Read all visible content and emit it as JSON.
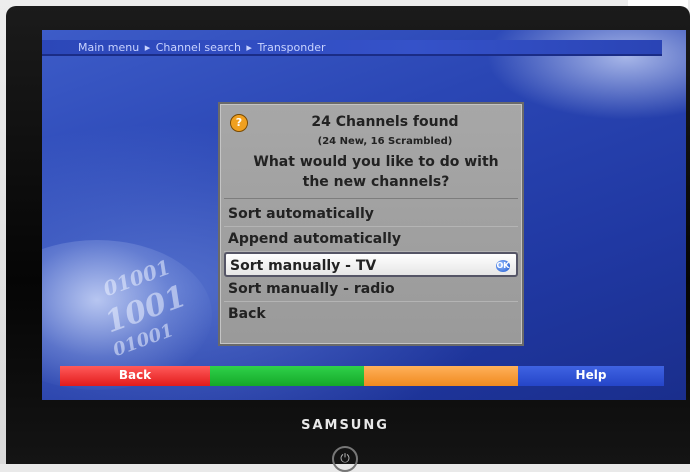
{
  "breadcrumb": {
    "items": [
      "Main menu",
      "Channel search",
      "Transponder"
    ],
    "separator": "▸"
  },
  "dialog": {
    "icon": "question-icon",
    "icon_glyph": "?",
    "title": "24 Channels found",
    "subtitle": "(24 New, 16 Scrambled)",
    "question_line1": "What would you like to do with",
    "question_line2": "the new channels?",
    "options": [
      "Sort automatically",
      "Append automatically",
      "Sort manually - TV",
      "Sort manually - radio",
      "Back"
    ],
    "selected_index": 2
  },
  "color_keys": {
    "red": "Back",
    "green": "",
    "yellow": "",
    "blue": "Help"
  },
  "background_text": {
    "binary1": "01001",
    "binary2": "1001",
    "binary3": "01001"
  },
  "tv": {
    "brand": "SAMSUNG",
    "power_glyph": "⏻"
  },
  "colors": {
    "screen_blue": "#2a46b4",
    "dialog_grey": "#a7a7a7",
    "key_red": "#e21b1b",
    "key_green": "#15a829",
    "key_yellow": "#f08a1f",
    "key_blue": "#2545c8"
  }
}
